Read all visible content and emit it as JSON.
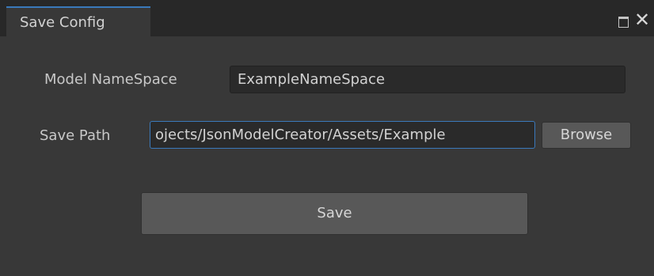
{
  "window": {
    "tab_title": "Save Config",
    "maximize_icon": "maximize-icon",
    "close_icon": "close-icon",
    "close_glyph": "✕"
  },
  "form": {
    "model_namespace_label": "Model NameSpace",
    "model_namespace_value": "ExampleNameSpace",
    "save_path_label": "Save Path",
    "save_path_value": "ojects/JsonModelCreator/Assets/Example",
    "browse_label": "Browse",
    "save_label": "Save"
  },
  "colors": {
    "background": "#383838",
    "titlebar": "#282828",
    "accent": "#3a79bb",
    "field_bg": "#2a2a2a",
    "button_bg": "#585858"
  }
}
